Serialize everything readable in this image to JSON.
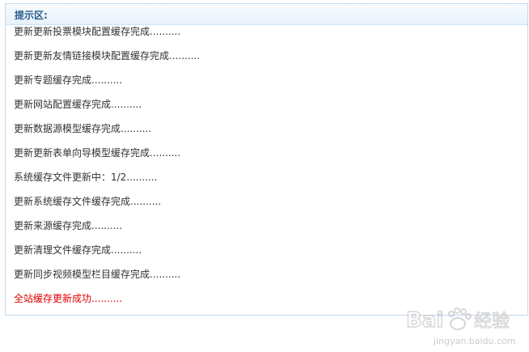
{
  "panel": {
    "title": "提示区:"
  },
  "log": [
    {
      "text": "更新更新投票模块配置缓存完成..........",
      "status": "normal"
    },
    {
      "text": "更新更新友情链接模块配置缓存完成..........",
      "status": "normal"
    },
    {
      "text": "更新专题缓存完成..........",
      "status": "normal"
    },
    {
      "text": "更新网站配置缓存完成..........",
      "status": "normal"
    },
    {
      "text": "更新数据源模型缓存完成..........",
      "status": "normal"
    },
    {
      "text": "更新更新表单向导模型缓存完成..........",
      "status": "normal"
    },
    {
      "text": "系统缓存文件更新中：1/2..........",
      "status": "normal"
    },
    {
      "text": "更新系统缓存文件缓存完成..........",
      "status": "normal"
    },
    {
      "text": "更新来源缓存完成..........",
      "status": "normal"
    },
    {
      "text": "更新清理文件缓存完成..........",
      "status": "normal"
    },
    {
      "text": "更新同步视频模型栏目缓存完成..........",
      "status": "normal"
    },
    {
      "text": "全站缓存更新成功..........",
      "status": "success"
    }
  ],
  "colors": {
    "normal_text": "#333333",
    "success_text": "#e00000",
    "title_text": "#2b5c8c",
    "border": "#c4d8ec"
  },
  "watermark": {
    "logo_text": "Bai 经验",
    "url_text": "jingyan.baidu.com"
  }
}
